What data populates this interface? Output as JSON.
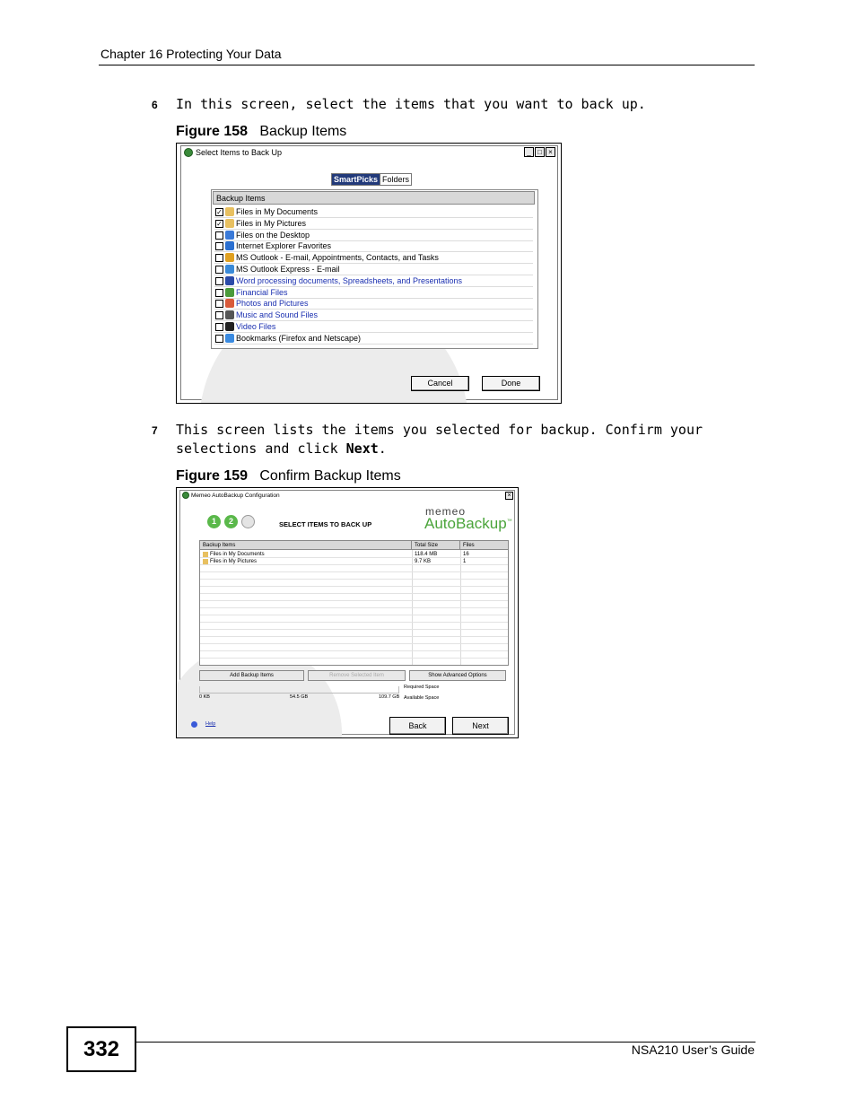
{
  "header": {
    "chapter": "Chapter 16 Protecting Your Data"
  },
  "step6": {
    "number": "6",
    "text": "In this screen, select the items that you want to back up."
  },
  "figure158": {
    "label": "Figure 158",
    "title": "Backup Items",
    "window": {
      "title": "Select Items to Back Up",
      "min_glyph": "_",
      "max_glyph": "□",
      "close_glyph": "×",
      "tabs": [
        "SmartPicks",
        "Folders"
      ],
      "list_header": "Backup Items",
      "items": [
        {
          "label": "Files in My Documents",
          "checked": true,
          "icon": "folder-documents-icon",
          "color": "#e8c060"
        },
        {
          "label": "Files in My Pictures",
          "checked": true,
          "icon": "folder-pictures-icon",
          "color": "#e8c060"
        },
        {
          "label": "Files on the Desktop",
          "checked": false,
          "icon": "desktop-icon",
          "color": "#3a7ad8"
        },
        {
          "label": "Internet Explorer Favorites",
          "checked": false,
          "icon": "internet-explorer-icon",
          "color": "#2a6fd0"
        },
        {
          "label": "MS Outlook - E-mail, Appointments, Contacts, and Tasks",
          "checked": false,
          "icon": "outlook-icon",
          "color": "#e0a020"
        },
        {
          "label": "MS Outlook Express - E-mail",
          "checked": false,
          "icon": "outlook-express-icon",
          "color": "#3a8ad8"
        },
        {
          "label": "Word processing documents, Spreadsheets, and Presentations",
          "checked": false,
          "icon": "office-documents-icon",
          "color": "#2a4aa8",
          "blue": true
        },
        {
          "label": "Financial Files",
          "checked": false,
          "icon": "financial-files-icon",
          "color": "#4a9a3a",
          "blue": true
        },
        {
          "label": "Photos and Pictures",
          "checked": false,
          "icon": "photos-icon",
          "color": "#d85a3a",
          "blue": true
        },
        {
          "label": "Music and Sound Files",
          "checked": false,
          "icon": "music-icon",
          "color": "#555555",
          "blue": true
        },
        {
          "label": "Video Files",
          "checked": false,
          "icon": "video-icon",
          "color": "#222222",
          "blue": true
        },
        {
          "label": "Bookmarks (Firefox and Netscape)",
          "checked": false,
          "icon": "bookmarks-icon",
          "color": "#3a8ae0"
        }
      ],
      "cancel": "Cancel",
      "done": "Done"
    }
  },
  "step7": {
    "number": "7",
    "text_before": "This screen lists the items you selected for backup. Confirm your selections and click ",
    "text_bold": "Next",
    "text_after": "."
  },
  "figure159": {
    "label": "Figure 159",
    "title": "Confirm Backup Items",
    "window": {
      "title": "Memeo AutoBackup Configuration",
      "close_glyph": "×",
      "steps": [
        "1",
        "2",
        ""
      ],
      "heading": "SELECT ITEMS TO BACK UP",
      "logo_top": "memeo",
      "logo_main": "AutoBackup",
      "logo_tm": "™",
      "columns": [
        "Backup Items",
        "Total Size",
        "Files"
      ],
      "rows": [
        {
          "item": "Files in My Documents",
          "size": "118.4 MB",
          "files": "16"
        },
        {
          "item": "Files in My Pictures",
          "size": "9.7 KB",
          "files": "1"
        }
      ],
      "buttons": [
        "Add Backup Items",
        "Remove Selected Item",
        "Show Advanced Options"
      ],
      "scale": [
        "0 KB",
        "54.5 GB",
        "109.7 GB"
      ],
      "required_space": "Required Space",
      "available_space": "Available Space",
      "help": "Help",
      "back": "Back",
      "next": "Next"
    }
  },
  "footer": {
    "page_number": "332",
    "guide": "NSA210 User’s Guide"
  }
}
